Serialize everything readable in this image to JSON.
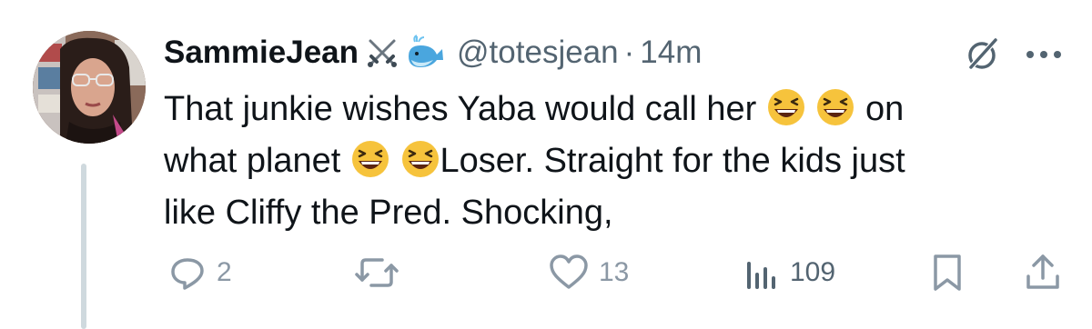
{
  "author": {
    "display_name": "SammieJean",
    "badges": [
      "crossed-swords-icon",
      "whale-icon"
    ],
    "handle": "@totesjean",
    "separator": "·",
    "time": "14m"
  },
  "tweet": {
    "line1_a": "That junkie wishes Yaba would call her",
    "line1_b": "on",
    "line2_a": "what planet",
    "line2_b": "Loser. Straight for the kids just",
    "line3": "like Cliffy the Pred. Shocking,",
    "emoji": "laughing-face-icon"
  },
  "actions": {
    "replies": "2",
    "reposts": "",
    "likes": "13",
    "views": "109"
  },
  "colors": {
    "text": "#0f1419",
    "secondary": "#536471",
    "icon": "#8b98a5",
    "thread_line": "#cfd9de"
  }
}
